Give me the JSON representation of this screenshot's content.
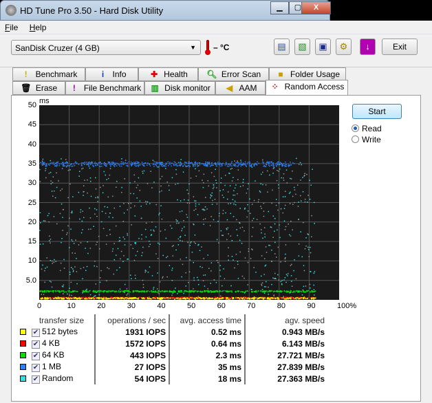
{
  "window": {
    "title": "HD Tune Pro 3.50 - Hard Disk Utility",
    "minimize": "▁",
    "maximize": "▢",
    "close": "X"
  },
  "menu": [
    {
      "label": "File",
      "accel": "F",
      "rest": "ile"
    },
    {
      "label": "Help",
      "accel": "H",
      "rest": "elp"
    }
  ],
  "toolbar": {
    "drive": "SanDisk Cruzer (4 GB)",
    "temperature": "– °C",
    "exit": "Exit",
    "buttons": [
      "copy-text-icon",
      "copy-screenshot-icon",
      "save-icon",
      "options-icon",
      "download-icon"
    ]
  },
  "tabs_row1": [
    "Benchmark",
    "Info",
    "Health",
    "Error Scan",
    "Folder Usage"
  ],
  "tabs_row2": [
    "Erase",
    "File Benchmark",
    "Disk monitor",
    "AAM",
    "Random Access"
  ],
  "active_tab": "Random Access",
  "controls": {
    "start": "Start",
    "read": "Read",
    "write": "Write",
    "selected": "Read"
  },
  "chart_data": {
    "type": "scatter",
    "ylabel": "ms",
    "yticks": [
      "50",
      "45",
      "40",
      "35",
      "30",
      "25",
      "20",
      "15",
      "10",
      "5.0"
    ],
    "xticks": [
      "0",
      "10",
      "20",
      "30",
      "40",
      "50",
      "60",
      "70",
      "80",
      "90",
      "100%"
    ],
    "xlim": [
      0,
      100
    ],
    "ylim": [
      0,
      50
    ],
    "grid": true,
    "series": [
      {
        "name": "512 bytes",
        "color": "#ffff00",
        "level_ms": 0.52
      },
      {
        "name": "4 KB",
        "color": "#ff0000",
        "level_ms": 0.64
      },
      {
        "name": "64 KB",
        "color": "#00e000",
        "level_ms": 2.3
      },
      {
        "name": "1 MB",
        "color": "#2a7fff",
        "level_ms": 35
      },
      {
        "name": "Random",
        "color": "#30e0e0",
        "level_ms": 18
      }
    ]
  },
  "results": {
    "headers": [
      "transfer size",
      "operations / sec",
      "avg. access time",
      "agv. speed"
    ],
    "rows": [
      {
        "size": "512 bytes",
        "ops": "1931 IOPS",
        "access": "0.52 ms",
        "speed": "0.943 MB/s",
        "color": "#ffff00",
        "checked": true
      },
      {
        "size": "4 KB",
        "ops": "1572 IOPS",
        "access": "0.64 ms",
        "speed": "6.143 MB/s",
        "color": "#ff0000",
        "checked": true
      },
      {
        "size": "64 KB",
        "ops": "443 IOPS",
        "access": "2.3 ms",
        "speed": "27.721 MB/s",
        "color": "#00e000",
        "checked": true
      },
      {
        "size": "1 MB",
        "ops": "27 IOPS",
        "access": "35 ms",
        "speed": "27.839 MB/s",
        "color": "#2a7fff",
        "checked": true
      },
      {
        "size": "Random",
        "ops": "54 IOPS",
        "access": "18 ms",
        "speed": "27.363 MB/s",
        "color": "#30e0e0",
        "checked": true
      }
    ]
  }
}
